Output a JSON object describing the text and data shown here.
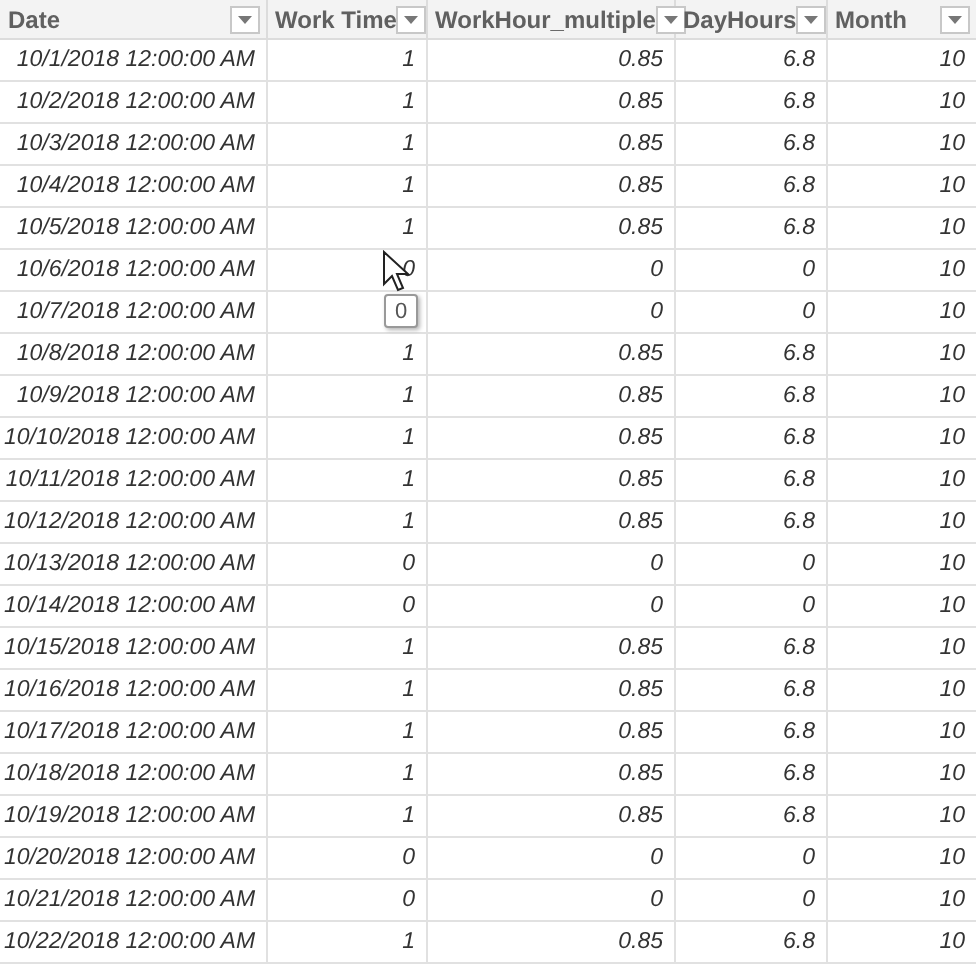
{
  "table": {
    "columns": [
      "Date",
      "Work Time",
      "WorkHour_multiple",
      "DayHours",
      "Month"
    ],
    "rows": [
      [
        "10/1/2018 12:00:00 AM",
        "1",
        "0.85",
        "6.8",
        "10"
      ],
      [
        "10/2/2018 12:00:00 AM",
        "1",
        "0.85",
        "6.8",
        "10"
      ],
      [
        "10/3/2018 12:00:00 AM",
        "1",
        "0.85",
        "6.8",
        "10"
      ],
      [
        "10/4/2018 12:00:00 AM",
        "1",
        "0.85",
        "6.8",
        "10"
      ],
      [
        "10/5/2018 12:00:00 AM",
        "1",
        "0.85",
        "6.8",
        "10"
      ],
      [
        "10/6/2018 12:00:00 AM",
        "0",
        "0",
        "0",
        "10"
      ],
      [
        "10/7/2018 12:00:00 AM",
        null,
        "0",
        "0",
        "10"
      ],
      [
        "10/8/2018 12:00:00 AM",
        "1",
        "0.85",
        "6.8",
        "10"
      ],
      [
        "10/9/2018 12:00:00 AM",
        "1",
        "0.85",
        "6.8",
        "10"
      ],
      [
        "10/10/2018 12:00:00 AM",
        "1",
        "0.85",
        "6.8",
        "10"
      ],
      [
        "10/11/2018 12:00:00 AM",
        "1",
        "0.85",
        "6.8",
        "10"
      ],
      [
        "10/12/2018 12:00:00 AM",
        "1",
        "0.85",
        "6.8",
        "10"
      ],
      [
        "10/13/2018 12:00:00 AM",
        "0",
        "0",
        "0",
        "10"
      ],
      [
        "10/14/2018 12:00:00 AM",
        "0",
        "0",
        "0",
        "10"
      ],
      [
        "10/15/2018 12:00:00 AM",
        "1",
        "0.85",
        "6.8",
        "10"
      ],
      [
        "10/16/2018 12:00:00 AM",
        "1",
        "0.85",
        "6.8",
        "10"
      ],
      [
        "10/17/2018 12:00:00 AM",
        "1",
        "0.85",
        "6.8",
        "10"
      ],
      [
        "10/18/2018 12:00:00 AM",
        "1",
        "0.85",
        "6.8",
        "10"
      ],
      [
        "10/19/2018 12:00:00 AM",
        "1",
        "0.85",
        "6.8",
        "10"
      ],
      [
        "10/20/2018 12:00:00 AM",
        "0",
        "0",
        "0",
        "10"
      ],
      [
        "10/21/2018 12:00:00 AM",
        "0",
        "0",
        "0",
        "10"
      ],
      [
        "10/22/2018 12:00:00 AM",
        "1",
        "0.85",
        "6.8",
        "10"
      ]
    ]
  },
  "tooltip": {
    "text": "0"
  }
}
